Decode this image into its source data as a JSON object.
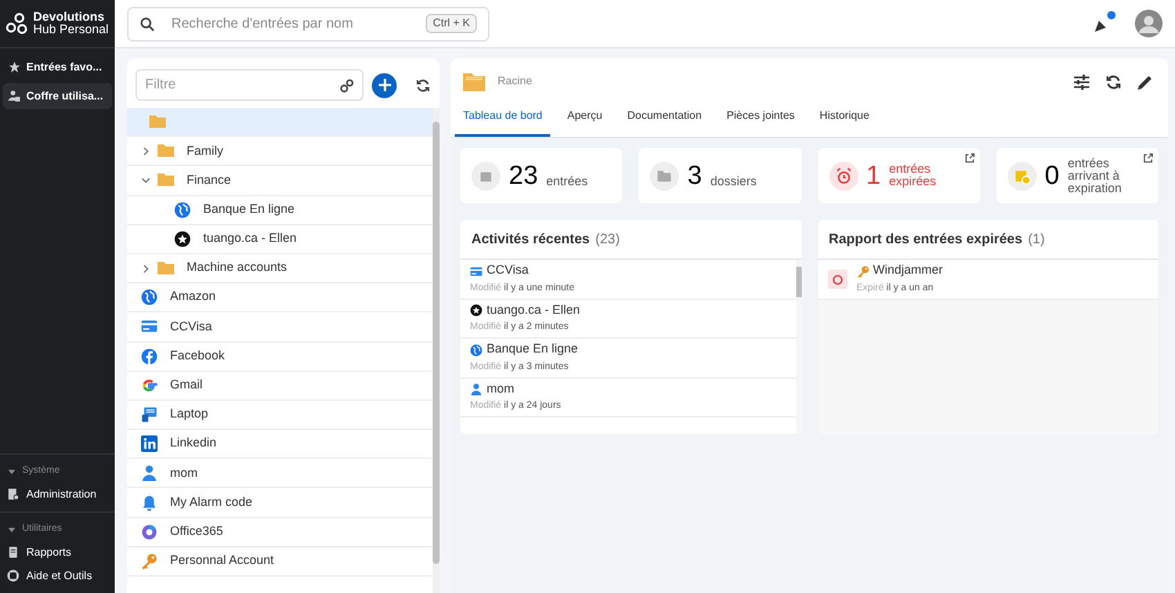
{
  "app": {
    "logo_line1": "Devolutions",
    "logo_line2": "Hub Personal"
  },
  "sidebar": {
    "items": [
      {
        "label": "Entrées favo...",
        "kind": "star",
        "selected": false
      },
      {
        "label": "Coffre utilisa...",
        "kind": "vault",
        "selected": true
      }
    ],
    "sections": [
      {
        "title": "Système",
        "expanded": true,
        "items": [
          {
            "label": "Administration",
            "kind": "admin"
          }
        ]
      },
      {
        "title": "Utilitaires",
        "expanded": true,
        "items": [
          {
            "label": "Rapports",
            "kind": "report"
          },
          {
            "label": "Aide et Outils",
            "kind": "help"
          }
        ]
      }
    ]
  },
  "search": {
    "placeholder": "Recherche d'entrées par nom",
    "shortcut": "Ctrl + K"
  },
  "notifications": {
    "unread": true
  },
  "tree": {
    "filter_placeholder": "Filtre",
    "root": {
      "kind": "folder",
      "selected": true,
      "children": [
        {
          "label": "Family",
          "kind": "folder",
          "expanded": false,
          "selected": false
        },
        {
          "label": "Finance",
          "kind": "folder",
          "expanded": true,
          "selected": false,
          "children": [
            {
              "label": "Banque En ligne",
              "kind": "web",
              "selected": false
            },
            {
              "label": "tuango.ca - Ellen",
              "kind": "badge",
              "selected": false
            }
          ]
        },
        {
          "label": "Machine accounts",
          "kind": "folder",
          "expanded": false,
          "selected": false
        },
        {
          "label": "Amazon",
          "kind": "web",
          "selected": false
        },
        {
          "label": "CCVisa",
          "kind": "card",
          "selected": false
        },
        {
          "label": "Facebook",
          "kind": "facebook",
          "selected": false
        },
        {
          "label": "Gmail",
          "kind": "google",
          "selected": false
        },
        {
          "label": "Laptop",
          "kind": "computer",
          "selected": false
        },
        {
          "label": "Linkedin",
          "kind": "linkedin",
          "selected": false
        },
        {
          "label": "mom",
          "kind": "user",
          "selected": false
        },
        {
          "label": "My Alarm code",
          "kind": "alarm",
          "selected": false
        },
        {
          "label": "Office365",
          "kind": "office",
          "selected": false
        },
        {
          "label": "Personnal Account",
          "kind": "key",
          "selected": false
        }
      ]
    }
  },
  "detail": {
    "title": "Racine",
    "tabs": [
      {
        "label": "Tableau de bord",
        "selected": true
      },
      {
        "label": "Aperçu",
        "selected": false
      },
      {
        "label": "Documentation",
        "selected": false
      },
      {
        "label": "Pièces jointes",
        "selected": false
      },
      {
        "label": "Historique",
        "selected": false
      }
    ],
    "stats": [
      {
        "kind": "entries",
        "value": "23",
        "label": "entrées"
      },
      {
        "kind": "folders",
        "value": "3",
        "label": "dossiers"
      },
      {
        "kind": "expired",
        "value": "1",
        "label": "entrées expirées"
      },
      {
        "kind": "expiring",
        "value": "0",
        "label": "entrées arrivant à expiration"
      }
    ],
    "recent": {
      "title": "Activités récentes",
      "count": "(23)",
      "items": [
        {
          "name": "CCVisa",
          "kind": "card",
          "action": "Modifié",
          "time": "il y a une minute"
        },
        {
          "name": "tuango.ca - Ellen",
          "kind": "badge",
          "action": "Modifié",
          "time": "il y a 2 minutes"
        },
        {
          "name": "Banque En ligne",
          "kind": "web",
          "action": "Modifié",
          "time": "il y a 3 minutes"
        },
        {
          "name": "mom",
          "kind": "user",
          "action": "Modifié",
          "time": "il y a 24 jours"
        }
      ]
    },
    "expired": {
      "title": "Rapport des entrées expirées",
      "count": "(1)",
      "items": [
        {
          "name": "Windjammer",
          "kind": "key",
          "action": "Expiré",
          "time": "il y a un an"
        }
      ]
    }
  }
}
